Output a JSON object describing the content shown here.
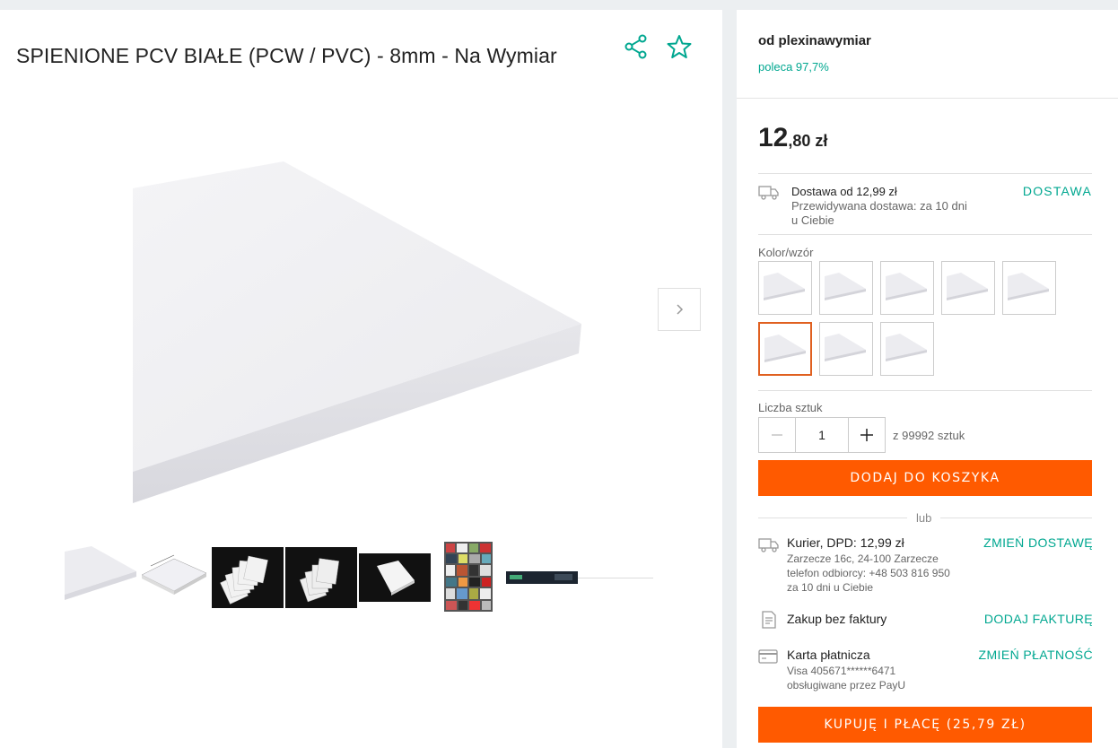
{
  "product": {
    "title": "SPIENIONE PCV BIAŁE (PCW / PVC) - 8mm - Na Wymiar"
  },
  "seller": {
    "name": "od plexinawymiar",
    "rating": "poleca 97,7%"
  },
  "price": {
    "integer": "12",
    "rest": ",80 zł"
  },
  "delivery": {
    "line1": "Dostawa od 12,99 zł",
    "line2": "Przewidywana dostawa: za 10 dni",
    "line3": "u Ciebie",
    "link": "DOSTAWA"
  },
  "variants": {
    "label": "Kolor/wzór",
    "count": 8,
    "selected_index": 5
  },
  "quantity": {
    "label": "Liczba sztuk",
    "value": "1",
    "available": "z 99992 sztuk"
  },
  "buttons": {
    "add_to_cart": "DODAJ DO KOSZYKA",
    "or": "lub",
    "buy_now": "KUPUJĘ I PŁACĘ (25,79 ZŁ)"
  },
  "shipping": {
    "title": "Kurier, DPD: 12,99 zł",
    "address": "Zarzecze 16c, 24-100 Zarzecze",
    "phone": "telefon odbiorcy: +48 503 816 950",
    "eta": "za 10 dni u Ciebie",
    "link": "ZMIEŃ DOSTAWĘ"
  },
  "invoice": {
    "title": "Zakup bez faktury",
    "link": "DODAJ FAKTURĘ"
  },
  "payment": {
    "title": "Karta płatnicza",
    "card": "Visa 405671******6471",
    "processor": "obsługiwane przez PayU",
    "link": "ZMIEŃ PŁATNOŚĆ"
  },
  "gallery": {
    "thumbnail_count": 7,
    "active_index": 0
  },
  "colors": {
    "accent": "#ff5a00",
    "link": "#00a790"
  }
}
